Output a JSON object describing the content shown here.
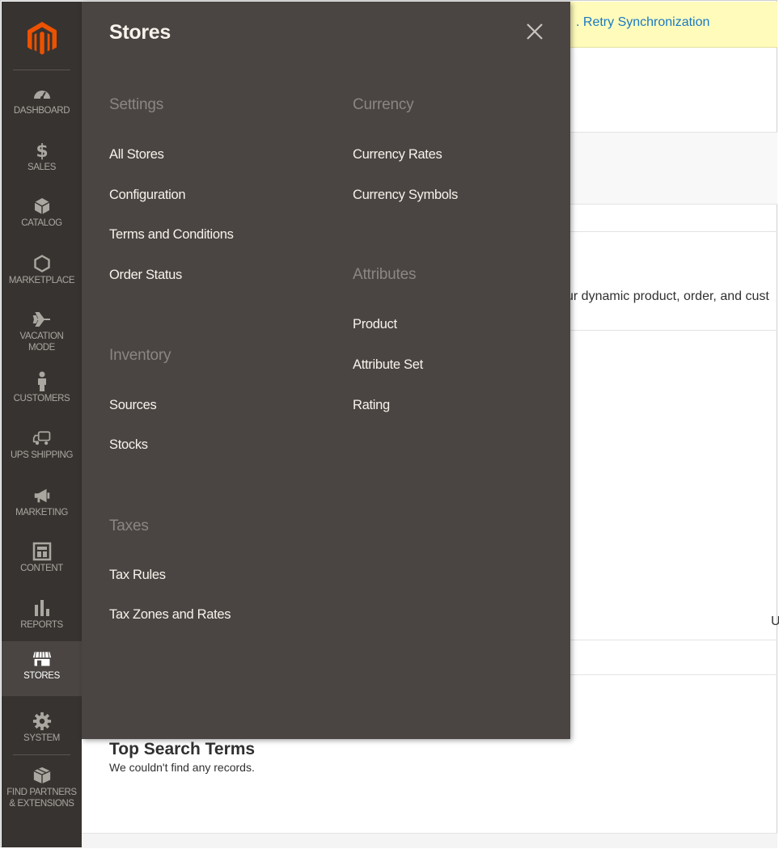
{
  "sidebar": {
    "logo_icon": "magento-logo-icon",
    "items": [
      {
        "label": "DASHBOARD",
        "icon": "speedometer-icon"
      },
      {
        "label": "SALES",
        "icon": "dollar-icon"
      },
      {
        "label": "CATALOG",
        "icon": "cube-icon"
      },
      {
        "label": "MARKETPLACE",
        "icon": "hexagon-icon"
      },
      {
        "label": "VACATION\nMODE",
        "icon": "airplane-icon"
      },
      {
        "label": "CUSTOMERS",
        "icon": "person-icon"
      },
      {
        "label": "UPS SHIPPING",
        "icon": "truck-icon"
      },
      {
        "label": "MARKETING",
        "icon": "megaphone-icon"
      },
      {
        "label": "CONTENT",
        "icon": "layout-icon"
      },
      {
        "label": "REPORTS",
        "icon": "bar-chart-icon"
      },
      {
        "label": "STORES",
        "icon": "storefront-icon",
        "active": true
      },
      {
        "label": "SYSTEM",
        "icon": "gear-icon"
      },
      {
        "label": "FIND PARTNERS\n& EXTENSIONS",
        "icon": "box-icon"
      }
    ]
  },
  "background": {
    "notice_link": ". Retry Synchronization",
    "description_fragment": "ur dynamic product, order, and cust",
    "cut_off_letter": "U",
    "top_search_title": "Top Search Terms",
    "top_search_empty": "We couldn't find any records."
  },
  "flyout": {
    "title": "Stores",
    "close_icon": "close-icon",
    "settings": {
      "title": "Settings",
      "links": [
        "All Stores",
        "Configuration",
        "Terms and Conditions",
        "Order Status"
      ]
    },
    "inventory": {
      "title": "Inventory",
      "links": [
        "Sources",
        "Stocks"
      ]
    },
    "taxes": {
      "title": "Taxes",
      "links": [
        "Tax Rules",
        "Tax Zones and Rates"
      ]
    },
    "currency": {
      "title": "Currency",
      "links": [
        "Currency Rates",
        "Currency Symbols"
      ]
    },
    "attributes": {
      "title": "Attributes",
      "links": [
        "Product",
        "Attribute Set",
        "Rating"
      ]
    }
  },
  "colors": {
    "sidebar_bg": "#373330",
    "flyout_bg": "#4a4542",
    "logo_orange": "#eb5202",
    "notice_bg": "#fffbbb",
    "link_blue": "#1979c3"
  }
}
